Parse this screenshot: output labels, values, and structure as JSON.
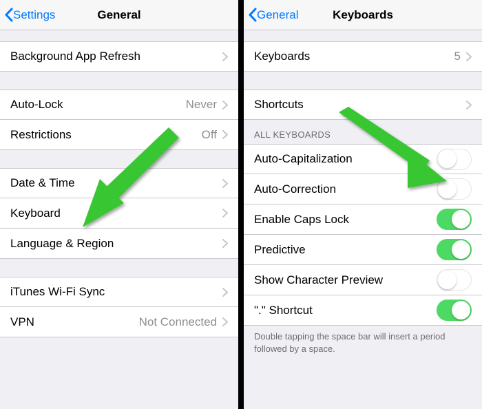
{
  "left": {
    "back_label": "Settings",
    "title": "General",
    "rows": {
      "bg_refresh": "Background App Refresh",
      "auto_lock": {
        "label": "Auto-Lock",
        "value": "Never"
      },
      "restrictions": {
        "label": "Restrictions",
        "value": "Off"
      },
      "date_time": "Date & Time",
      "keyboard": "Keyboard",
      "lang_region": "Language & Region",
      "itunes": "iTunes Wi-Fi Sync",
      "vpn": {
        "label": "VPN",
        "value": "Not Connected"
      }
    }
  },
  "right": {
    "back_label": "General",
    "title": "Keyboards",
    "rows": {
      "keyboards": {
        "label": "Keyboards",
        "value": "5"
      },
      "shortcuts": "Shortcuts"
    },
    "section_header": "ALL KEYBOARDS",
    "toggles": {
      "auto_cap": {
        "label": "Auto-Capitalization",
        "on": false
      },
      "auto_correct": {
        "label": "Auto-Correction",
        "on": false
      },
      "caps_lock": {
        "label": "Enable Caps Lock",
        "on": true
      },
      "predictive": {
        "label": "Predictive",
        "on": true
      },
      "char_preview": {
        "label": "Show Character Preview",
        "on": false
      },
      "dot_shortcut": {
        "label": "\".\" Shortcut",
        "on": true
      }
    },
    "footer": "Double tapping the space bar will insert a period followed by a space."
  },
  "colors": {
    "link": "#007aff",
    "toggle_on": "#4cd964",
    "arrow": "#39c730"
  }
}
